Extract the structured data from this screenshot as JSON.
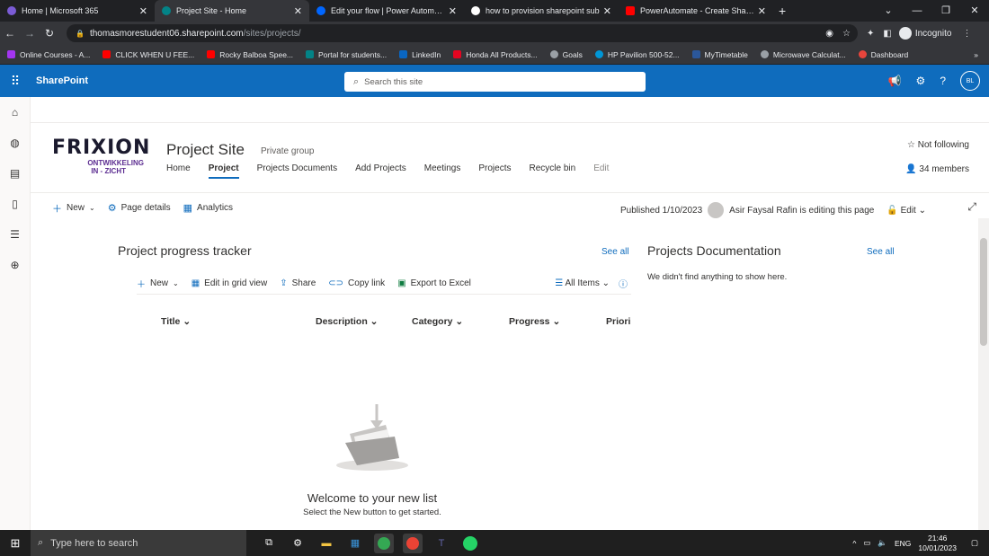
{
  "browser": {
    "tabs": [
      {
        "title": "Home | Microsoft 365",
        "color": "#7b5cd6",
        "active": false
      },
      {
        "title": "Project Site - Home",
        "color": "#038387",
        "active": true
      },
      {
        "title": "Edit your flow | Power Automate",
        "color": "#0066ff",
        "active": false
      },
      {
        "title": "how to provision sharepoint sub",
        "color": "#ffffff",
        "active": false
      },
      {
        "title": "PowerAutomate - Create ShareP",
        "color": "#ff0000",
        "active": false
      }
    ],
    "new_tab": "+",
    "url_host": "thomasmorestudent06.sharepoint.com",
    "url_path": "/sites/projects/",
    "incognito_label": "Incognito",
    "bookmarks": [
      {
        "label": "Online Courses - A...",
        "color": "#a435f0"
      },
      {
        "label": "CLICK WHEN U FEE...",
        "color": "#ff0000"
      },
      {
        "label": "Rocky Balboa Spee...",
        "color": "#ff0000"
      },
      {
        "label": "Portal for students...",
        "color": "#038387"
      },
      {
        "label": "LinkedIn",
        "color": "#0a66c2"
      },
      {
        "label": "Honda All Products...",
        "color": "#e40521"
      },
      {
        "label": "Goals",
        "color": "#9aa0a6"
      },
      {
        "label": "HP Pavilion 500-52...",
        "color": "#0096d6"
      },
      {
        "label": "MyTimetable",
        "color": "#2b579a"
      },
      {
        "label": "Microwave Calculat...",
        "color": "#9aa0a6"
      },
      {
        "label": "Dashboard",
        "color": "#e8453c"
      }
    ],
    "bookmarks_more": "»"
  },
  "suite": {
    "app_name": "SharePoint",
    "search_placeholder": "Search this site",
    "avatar_initials": "BL",
    "help": "?"
  },
  "site": {
    "logo_text": "FRIXION",
    "logo_sub1": "ONTWIKKELING",
    "logo_sub2": "IN - ZICHT",
    "title": "Project Site",
    "group_type": "Private group",
    "nav": [
      {
        "label": "Home",
        "selected": false
      },
      {
        "label": "Project",
        "selected": true
      },
      {
        "label": "Projects Documents",
        "selected": false
      },
      {
        "label": "Add Projects",
        "selected": false
      },
      {
        "label": "Meetings",
        "selected": false
      },
      {
        "label": "Projects",
        "selected": false
      },
      {
        "label": "Recycle bin",
        "selected": false
      },
      {
        "label": "Edit",
        "selected": false
      }
    ],
    "follow": "Not following",
    "members": "34 members"
  },
  "command_bar": {
    "new": "New",
    "page_details": "Page details",
    "analytics": "Analytics",
    "published": "Published 1/10/2023",
    "editing": "Asir Faysal Rafin is editing this page",
    "edit": "Edit"
  },
  "tracker": {
    "title": "Project progress tracker",
    "see_all": "See all",
    "cmd_new": "New",
    "cmd_grid": "Edit in grid view",
    "cmd_share": "Share",
    "cmd_copy": "Copy link",
    "cmd_export": "Export to Excel",
    "view": "All Items",
    "columns": [
      "Title",
      "Description",
      "Category",
      "Progress",
      "Priori"
    ],
    "empty_title": "Welcome to your new list",
    "empty_sub": "Select the New button to get started."
  },
  "docs": {
    "title": "Projects Documentation",
    "see_all": "See all",
    "empty": "We didn't find anything to show here."
  },
  "taskbar": {
    "search_placeholder": "Type here to search",
    "lang": "ENG",
    "time": "21:46",
    "date": "10/01/2023"
  }
}
